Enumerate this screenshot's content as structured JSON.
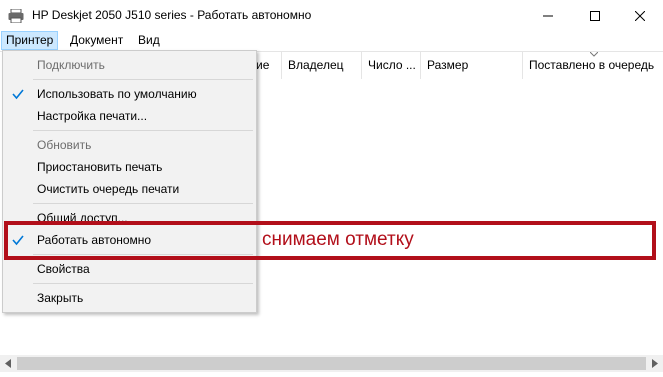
{
  "window": {
    "title": "HP Deskjet 2050 J510 series  -  Работать автономно",
    "icon": "printer-icon"
  },
  "menubar": {
    "items": [
      "Принтер",
      "Документ",
      "Вид"
    ]
  },
  "columns": [
    "ие",
    "Владелец",
    "Число ...",
    "Размер",
    "Поставлено в очередь"
  ],
  "printer_menu": {
    "items": [
      {
        "label": "Подключить",
        "disabled": true,
        "checked": false
      },
      {
        "label": "Использовать по умолчанию",
        "disabled": false,
        "checked": true
      },
      {
        "label": "Настройка печати...",
        "disabled": false,
        "checked": false
      },
      {
        "label": "Обновить",
        "disabled": true,
        "checked": false
      },
      {
        "label": "Приостановить печать",
        "disabled": false,
        "checked": false
      },
      {
        "label": "Очистить очередь печати",
        "disabled": false,
        "checked": false
      },
      {
        "label": "Общий доступ...",
        "disabled": false,
        "checked": false
      },
      {
        "label": "Работать автономно",
        "disabled": false,
        "checked": true
      },
      {
        "label": "Свойства",
        "disabled": false,
        "checked": false
      },
      {
        "label": "Закрыть",
        "disabled": false,
        "checked": false
      }
    ]
  },
  "annotation": {
    "text": "снимаем отметку",
    "color": "#b20f1a"
  },
  "colors": {
    "accent_check": "#0078d7",
    "menu_active_bg": "#cce8ff"
  }
}
